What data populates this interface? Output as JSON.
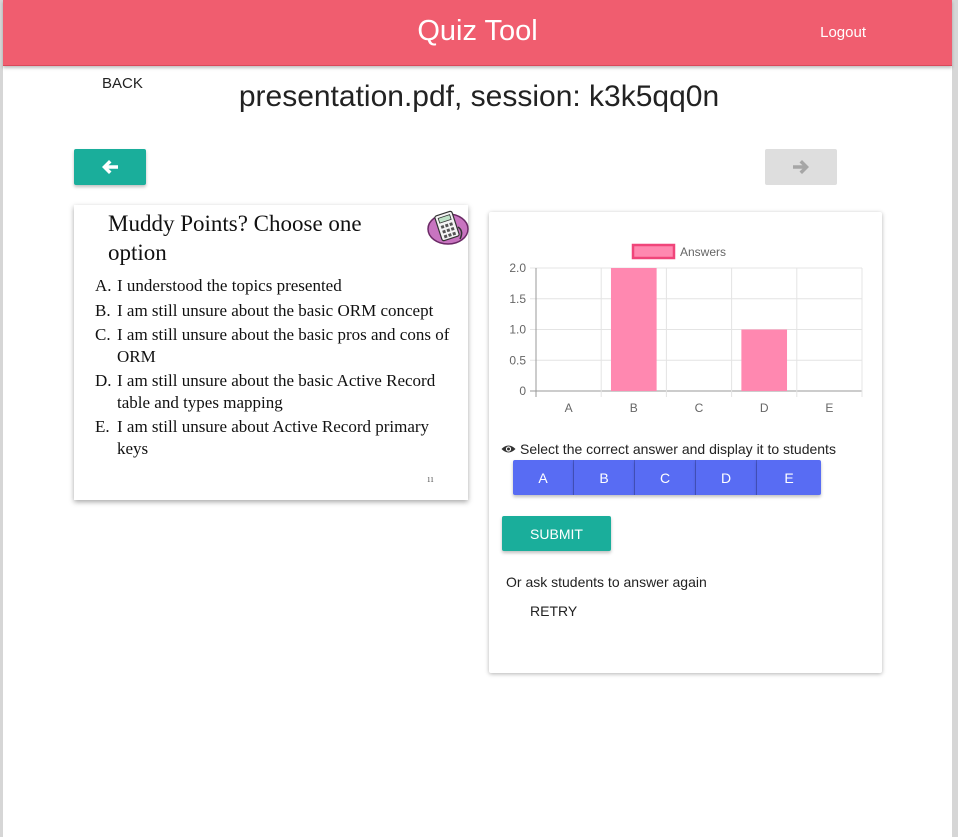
{
  "header": {
    "app_title": "Quiz Tool",
    "logout_label": "Logout"
  },
  "page": {
    "back_label": "BACK",
    "title": "presentation.pdf, session: k3k5qq0n"
  },
  "nav": {
    "prev_icon": "arrow-left-icon",
    "next_icon": "arrow-right-icon",
    "next_enabled": false
  },
  "slide": {
    "title": "Muddy Points? Choose one option",
    "icon": "calculator-sticker-icon",
    "options": [
      {
        "letter": "A.",
        "text": "I understood the topics presented"
      },
      {
        "letter": "B.",
        "text": "I am still unsure about the basic ORM concept"
      },
      {
        "letter": "C.",
        "text": "I am still unsure about the basic pros and cons of ORM"
      },
      {
        "letter": "D.",
        "text": "I am still unsure about the basic Active Record table and types mapping"
      },
      {
        "letter": "E.",
        "text": "I am still unsure about Active Record primary keys"
      }
    ],
    "page_number": "11"
  },
  "chart_data": {
    "type": "bar",
    "categories": [
      "A",
      "B",
      "C",
      "D",
      "E"
    ],
    "series": [
      {
        "name": "Answers",
        "values": [
          0,
          2,
          0,
          1,
          0
        ]
      }
    ],
    "ylim": [
      0,
      2
    ],
    "yticks": [
      "0",
      "0.5",
      "1.0",
      "1.5",
      "2.0"
    ],
    "legend": "top-center",
    "grid": true,
    "bar_color": "#ff88b0",
    "legend_border_color": "#f0457a"
  },
  "panel": {
    "prompt": "Select the correct answer and display it to students",
    "prompt_icon": "eye-icon",
    "answer_buttons": [
      "A",
      "B",
      "C",
      "D",
      "E"
    ],
    "submit_label": "SUBMIT",
    "ask_again_text": "Or ask students to answer again",
    "retry_label": "RETRY"
  },
  "colors": {
    "header": "#f05d6f",
    "primary": "#1aae9b",
    "answer_button": "#586cf3",
    "disabled": "#dedede"
  }
}
